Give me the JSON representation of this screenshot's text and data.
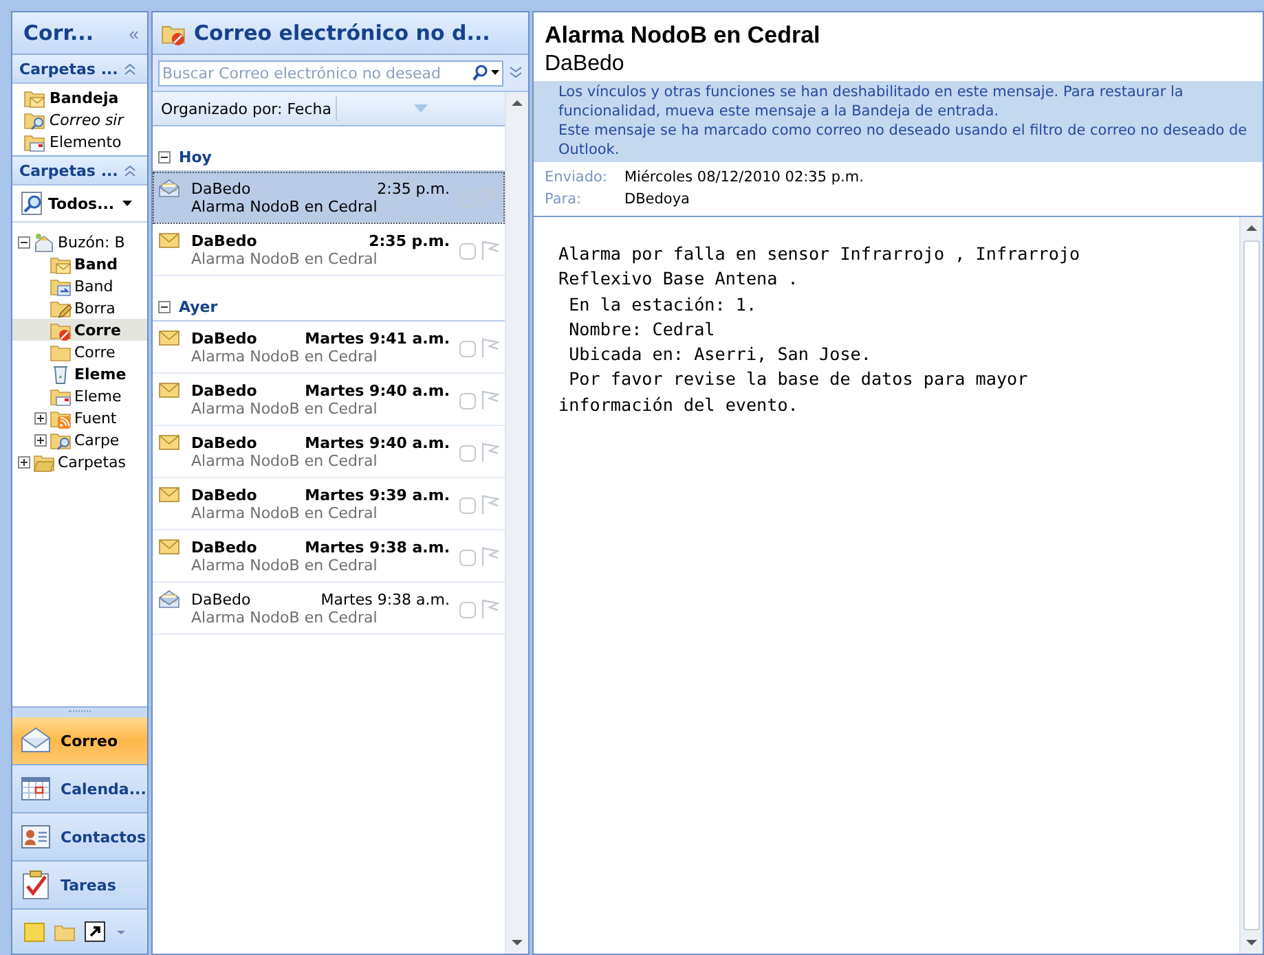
{
  "nav": {
    "title": "Corr...",
    "collapse": "«",
    "favorites": {
      "title": "Carpetas ...",
      "items": [
        {
          "label": "Bandeja",
          "kind": "inbox",
          "bold": true,
          "italic": false
        },
        {
          "label": "Correo sir",
          "kind": "search",
          "bold": false,
          "italic": true
        },
        {
          "label": "Elemento",
          "kind": "sent",
          "bold": false,
          "italic": false
        }
      ]
    },
    "folders": {
      "title": "Carpetas ...",
      "view": "Todos...",
      "tree": [
        {
          "label": "Buzón: B",
          "kind": "mailbox",
          "expanded": true,
          "bold": false,
          "selected": false,
          "children": [
            {
              "label": "Band",
              "kind": "inbox",
              "bold": true,
              "selected": false
            },
            {
              "label": "Band",
              "kind": "outbox",
              "bold": false,
              "selected": false
            },
            {
              "label": "Borra",
              "kind": "drafts",
              "bold": false,
              "selected": false
            },
            {
              "label": "Corre",
              "kind": "junk",
              "bold": true,
              "selected": true
            },
            {
              "label": "Corre",
              "kind": "folder",
              "bold": false,
              "selected": false
            },
            {
              "label": "Eleme",
              "kind": "trash",
              "bold": true,
              "selected": false
            },
            {
              "label": "Eleme",
              "kind": "sent",
              "bold": false,
              "selected": false
            },
            {
              "label": "Fuent",
              "kind": "rss",
              "expanded": false,
              "bold": false,
              "selected": false
            },
            {
              "label": "Carpe",
              "kind": "search",
              "expanded": false,
              "bold": false,
              "selected": false
            }
          ]
        },
        {
          "label": "Carpetas",
          "kind": "archive",
          "expanded": false,
          "bold": false,
          "selected": false
        }
      ]
    },
    "buttons": [
      {
        "label": "Correo",
        "kind": "mail",
        "selected": true
      },
      {
        "label": "Calenda...",
        "kind": "calendar",
        "selected": false
      },
      {
        "label": "Contactos",
        "kind": "contacts",
        "selected": false
      },
      {
        "label": "Tareas",
        "kind": "tasks",
        "selected": false
      }
    ]
  },
  "list": {
    "title": "Correo electrónico no d...",
    "search": {
      "placeholder": "Buscar Correo electrónico no desead"
    },
    "arrange": "Organizado por: Fecha",
    "groups": [
      {
        "label": "Hoy",
        "expanded": true,
        "messages": [
          {
            "sender": "DaBedo",
            "time": "2:35 p.m.",
            "subject": "Alarma NodoB en Cedral",
            "unread": false,
            "selected": true
          },
          {
            "sender": "DaBedo",
            "time": "2:35 p.m.",
            "subject": "Alarma NodoB en Cedral",
            "unread": true,
            "selected": false
          }
        ]
      },
      {
        "label": "Ayer",
        "expanded": true,
        "messages": [
          {
            "sender": "DaBedo",
            "time": "Martes 9:41 a.m.",
            "subject": "Alarma NodoB en Cedral",
            "unread": true,
            "selected": false
          },
          {
            "sender": "DaBedo",
            "time": "Martes 9:40 a.m.",
            "subject": "Alarma NodoB en Cedral",
            "unread": true,
            "selected": false
          },
          {
            "sender": "DaBedo",
            "time": "Martes 9:40 a.m.",
            "subject": "Alarma NodoB en Cedral",
            "unread": true,
            "selected": false
          },
          {
            "sender": "DaBedo",
            "time": "Martes 9:39 a.m.",
            "subject": "Alarma NodoB en Cedral",
            "unread": true,
            "selected": false
          },
          {
            "sender": "DaBedo",
            "time": "Martes 9:38 a.m.",
            "subject": "Alarma NodoB en Cedral",
            "unread": true,
            "selected": false
          },
          {
            "sender": "DaBedo",
            "time": "Martes 9:38 a.m.",
            "subject": "Alarma NodoB en Cedral",
            "unread": false,
            "selected": false
          }
        ]
      }
    ]
  },
  "reading": {
    "subject": "Alarma NodoB en Cedral",
    "sender": "DaBedo",
    "infobar": [
      "Los vínculos y otras funciones se han deshabilitado en este mensaje. Para restaurar la funcionalidad, mueva este mensaje a la Bandeja de entrada.",
      "Este mensaje se ha marcado como correo no deseado usando el filtro de correo no deseado de Outlook."
    ],
    "fields": [
      {
        "label": "Enviado:",
        "value": "Miércoles 08/12/2010 02:35 p.m."
      },
      {
        "label": "Para:",
        "value": "DBedoya"
      }
    ],
    "body": [
      "Alarma por falla en sensor Infrarrojo , Infrarrojo",
      "Reflexivo Base Antena .",
      " En la estación: 1.",
      " Nombre: Cedral",
      " Ubicada en: Aserri, San Jose.",
      " Por favor revise la base de datos para mayor",
      "información del evento."
    ]
  }
}
